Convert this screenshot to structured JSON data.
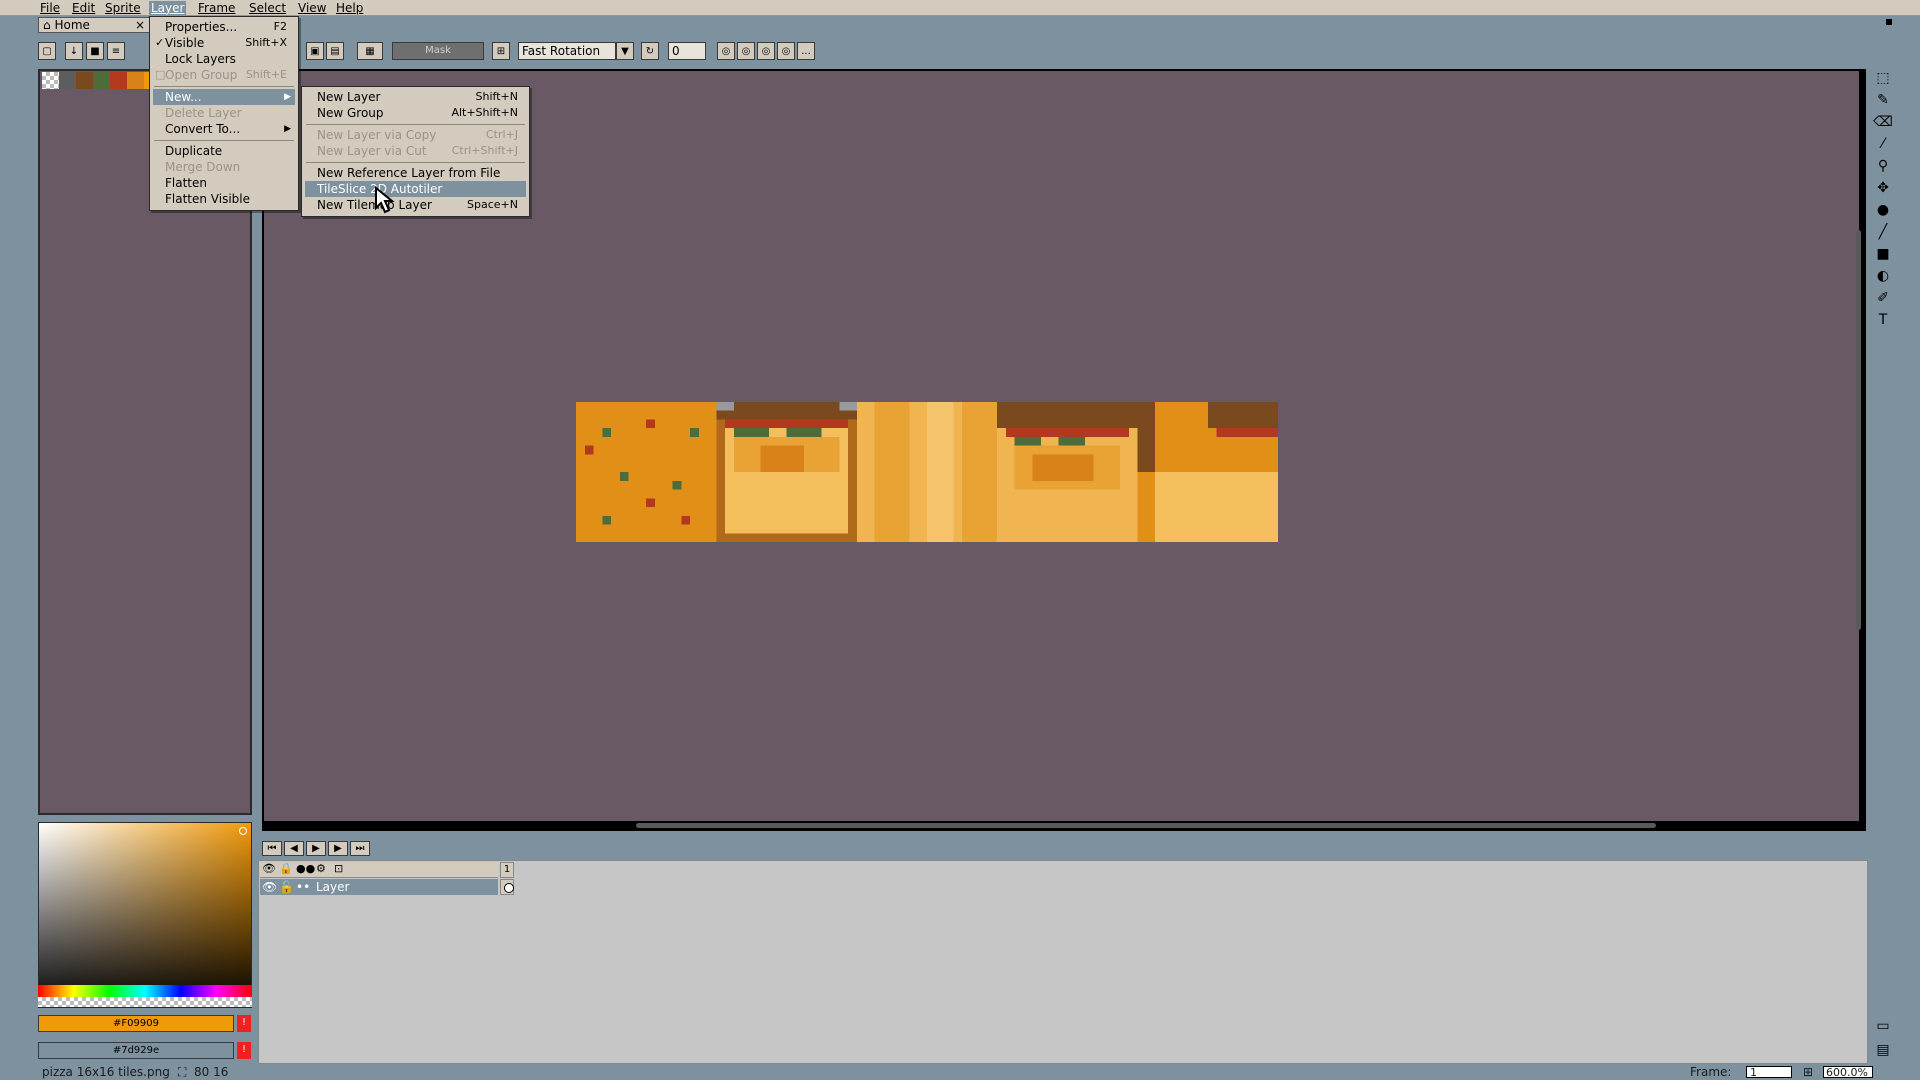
{
  "menubar": {
    "items": [
      "File",
      "Edit",
      "Sprite",
      "Layer",
      "Frame",
      "Select",
      "View",
      "Help"
    ],
    "active": "Layer"
  },
  "tab": {
    "label": "Home",
    "close": "×"
  },
  "toolbar": {
    "mask_label": "Mask",
    "rotation_algorithm": "Fast Rotation",
    "angle_value": "0",
    "more": "..."
  },
  "layer_menu": {
    "items": [
      {
        "label": "Properties...",
        "shortcut": "F2",
        "disabled": false,
        "checked": false,
        "submenu": false
      },
      {
        "label": "Visible",
        "shortcut": "Shift+X",
        "disabled": false,
        "checked": true,
        "submenu": false
      },
      {
        "label": "Lock Layers",
        "shortcut": "",
        "disabled": false,
        "checked": false,
        "submenu": false
      },
      {
        "label": "Open Group",
        "shortcut": "Shift+E",
        "disabled": true,
        "checked": false,
        "submenu": false
      },
      {
        "label": "New...",
        "shortcut": "",
        "disabled": false,
        "checked": false,
        "submenu": true,
        "highlight": true
      },
      {
        "label": "Delete Layer",
        "shortcut": "",
        "disabled": true,
        "checked": false,
        "submenu": false
      },
      {
        "label": "Convert To...",
        "shortcut": "",
        "disabled": false,
        "checked": false,
        "submenu": true
      },
      {
        "label": "Duplicate",
        "shortcut": "",
        "disabled": false,
        "checked": false,
        "submenu": false
      },
      {
        "label": "Merge Down",
        "shortcut": "",
        "disabled": true,
        "checked": false,
        "submenu": false
      },
      {
        "label": "Flatten",
        "shortcut": "",
        "disabled": false,
        "checked": false,
        "submenu": false
      },
      {
        "label": "Flatten Visible",
        "shortcut": "",
        "disabled": false,
        "checked": false,
        "submenu": false
      }
    ]
  },
  "new_submenu": {
    "items": [
      {
        "label": "New Layer",
        "shortcut": "Shift+N",
        "disabled": false
      },
      {
        "label": "New Group",
        "shortcut": "Alt+Shift+N",
        "disabled": false
      },
      {
        "label": "New Layer via Copy",
        "shortcut": "Ctrl+J",
        "disabled": true
      },
      {
        "label": "New Layer via Cut",
        "shortcut": "Ctrl+Shift+J",
        "disabled": true
      },
      {
        "label": "New Reference Layer from File",
        "shortcut": "",
        "disabled": false
      },
      {
        "label": "TileSlice 2D Autotiler",
        "shortcut": "",
        "disabled": false,
        "highlight": true
      },
      {
        "label": "New Tilemap Layer",
        "shortcut": "Space+N",
        "disabled": false
      }
    ]
  },
  "palette": {
    "colors": [
      "#5d5d5d",
      "#7a4a1e",
      "#4e6b3a",
      "#b2391e",
      "#d9821a",
      "#f09909"
    ]
  },
  "colors": {
    "foreground_hex": "#F09909",
    "background_hex": "#7d929e",
    "fg_color": "#f09909",
    "bg_color": "#7d929e",
    "canvas_bg": "#685965",
    "app_bg": "#7d929e",
    "menu_bg": "#d3cbbe",
    "highlight": "#7d929e"
  },
  "timeline": {
    "frame_header": "1",
    "layer_name": "Layer"
  },
  "status": {
    "filename": "pizza 16x16 tiles.png",
    "size": "80 16",
    "frame_label": "Frame:",
    "frame_value": "1",
    "zoom": "600.0%"
  },
  "tools": {
    "icons": [
      "marquee-icon",
      "pencil-icon",
      "eraser-icon",
      "eyedropper-icon",
      "zoom-icon",
      "move-icon",
      "fill-icon",
      "line-icon",
      "rectangle-icon",
      "contour-icon",
      "blur-icon",
      "text-icon"
    ]
  }
}
